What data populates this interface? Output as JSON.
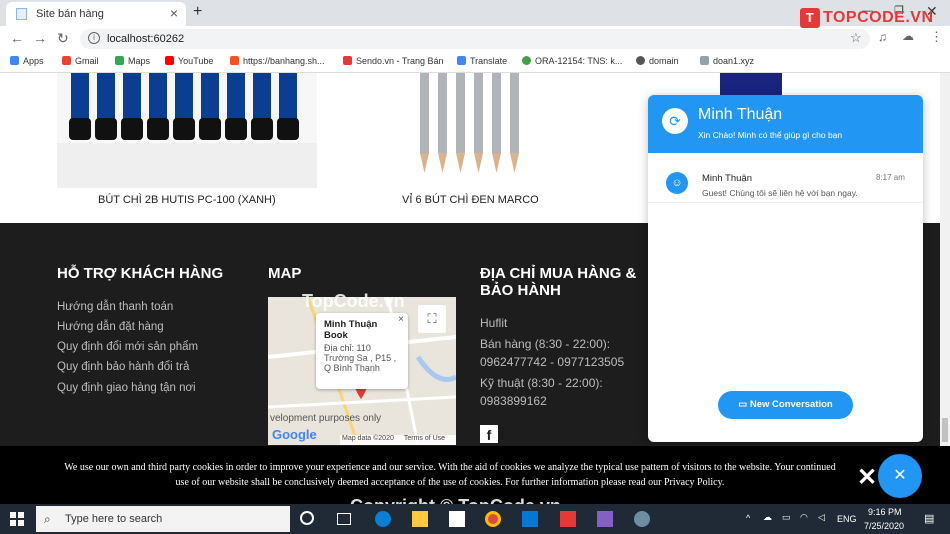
{
  "browser": {
    "tab_title": "Site bán hàng",
    "new_tab": "+",
    "url": "localhost:60262",
    "bookmarks": [
      "Apps",
      "Gmail",
      "Maps",
      "YouTube",
      "https://banhang.sh...",
      "Sendo.vn - Trang Bán",
      "Translate",
      "ORA-12154: TNS: k...",
      "domain",
      "doan1.xyz"
    ],
    "logo": "TOPCODE.VN"
  },
  "products": [
    {
      "name": "BÚT CHÌ 2B HUTIS PC-100 (XANH)"
    },
    {
      "name": "VỈ 6 BÚT CHÌ ĐEN MARCO"
    }
  ],
  "footer": {
    "support": {
      "title": "HỖ TRỢ KHÁCH HÀNG",
      "links": [
        "Hướng dẫn thanh toán",
        "Hướng dẫn đặt hàng",
        "Quy định đổi mới sản phẩm",
        "Quy định bảo hành đổi trả",
        "Quy định giao hàng tận nơi"
      ]
    },
    "map": {
      "title": "MAP",
      "watermark": "TopCode.vn",
      "info_name": "Minh Thuận Book",
      "info_addr": "Địa chỉ: 110 Trường Sa , P15 , Q Bình Thạnh",
      "dev_text": "velopment purposes only",
      "credit": "Map data ©2020",
      "terms": "Terms of Use",
      "google": "Google"
    },
    "address": {
      "title": "ĐỊA CHỈ MUA HÀNG & BẢO HÀNH",
      "store": "Huflit",
      "sales_label": "Bán hàng (8:30 - 22:00):",
      "sales_phone": "0962477742 - 0977123505",
      "tech_label": "Kỹ thuật (8:30 - 22:00):",
      "tech_phone": "0983899162"
    }
  },
  "chat": {
    "agent": "Minh Thuận",
    "greeting": "Xin Chào! Minh có thể giúp gì cho bạn",
    "msg_name": "Minh Thuận",
    "msg_time": "8:17 am",
    "msg_text": "Guest! Chúng tôi sẽ liên hệ với bạn ngay.",
    "button": "New Conversation"
  },
  "cookie": {
    "text": "We use our own and third party cookies in order to improve your experience and our service. With the aid of cookies we analyze the typical use pattern of visitors to the website. Your continued use of our website shall be conclusively deemed acceptance of the use of cookies. For further information please read our Privacy Policy.",
    "close": "✕"
  },
  "overlay_watermark": "Copyright © TopCode.vn",
  "taskbar": {
    "search_placeholder": "Type here to search",
    "lang": "ENG",
    "time": "9:16 PM",
    "date": "7/25/2020"
  },
  "colors": {
    "accent": "#2196f3",
    "footer_bg": "#1d1d1d",
    "logo": "#e53935"
  }
}
